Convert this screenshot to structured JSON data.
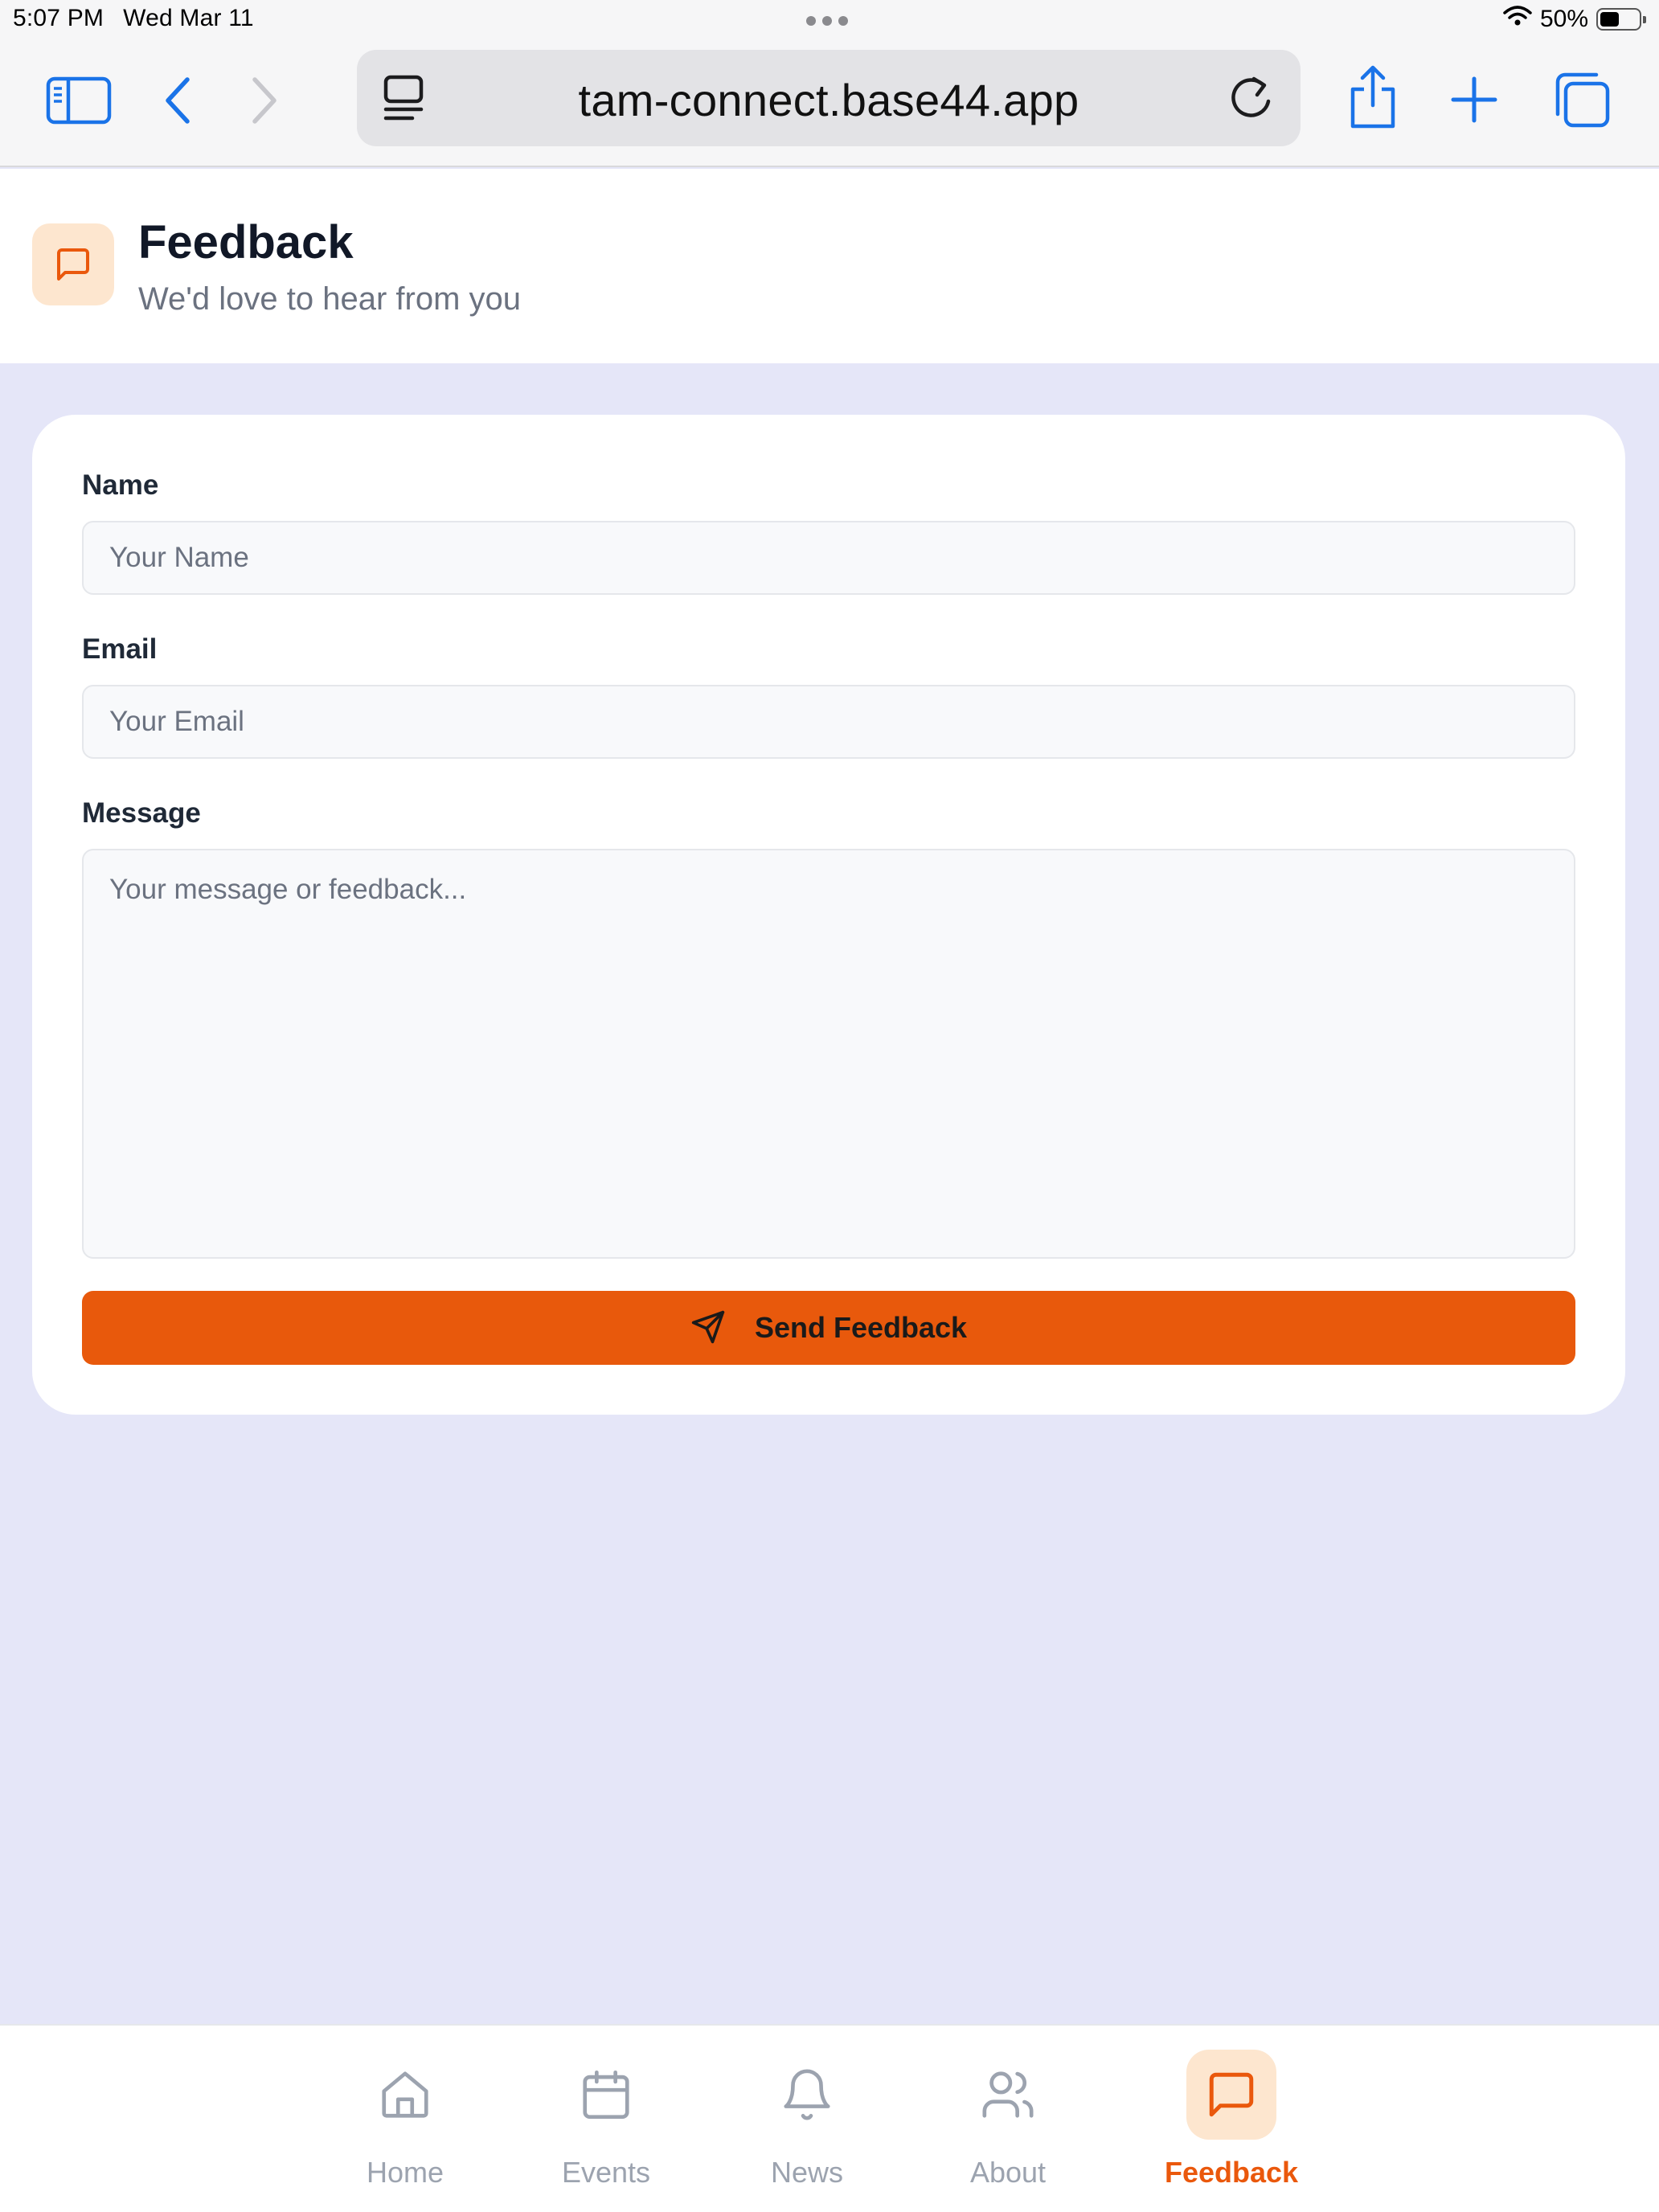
{
  "status_bar": {
    "time": "5:07 PM",
    "date": "Wed Mar 11",
    "battery_percent_text": "50%",
    "battery_level": 0.5
  },
  "browser": {
    "url": "tam-connect.base44.app",
    "icons": [
      "sidebar-icon",
      "back-icon",
      "forward-icon",
      "page-menu-icon",
      "reload-icon",
      "share-icon",
      "new-tab-icon",
      "tabs-icon"
    ]
  },
  "header": {
    "title": "Feedback",
    "subtitle": "We'd love to hear from you",
    "icon": "message-square-icon"
  },
  "form": {
    "name_label": "Name",
    "name_placeholder": "Your Name",
    "name_value": "",
    "email_label": "Email",
    "email_placeholder": "Your Email",
    "email_value": "",
    "message_label": "Message",
    "message_placeholder": "Your message or feedback...",
    "message_value": "",
    "submit_label": "Send Feedback"
  },
  "nav": {
    "items": [
      {
        "label": "Home",
        "icon": "home-icon",
        "active": false
      },
      {
        "label": "Events",
        "icon": "calendar-icon",
        "active": false
      },
      {
        "label": "News",
        "icon": "bell-icon",
        "active": false
      },
      {
        "label": "About",
        "icon": "users-icon",
        "active": false
      },
      {
        "label": "Feedback",
        "icon": "message-square-icon",
        "active": true
      }
    ]
  },
  "colors": {
    "accent": "#e8590c",
    "accent_soft": "#fde6cf",
    "page_bg": "#e5e6f8",
    "browser_blue": "#1a73e8"
  }
}
